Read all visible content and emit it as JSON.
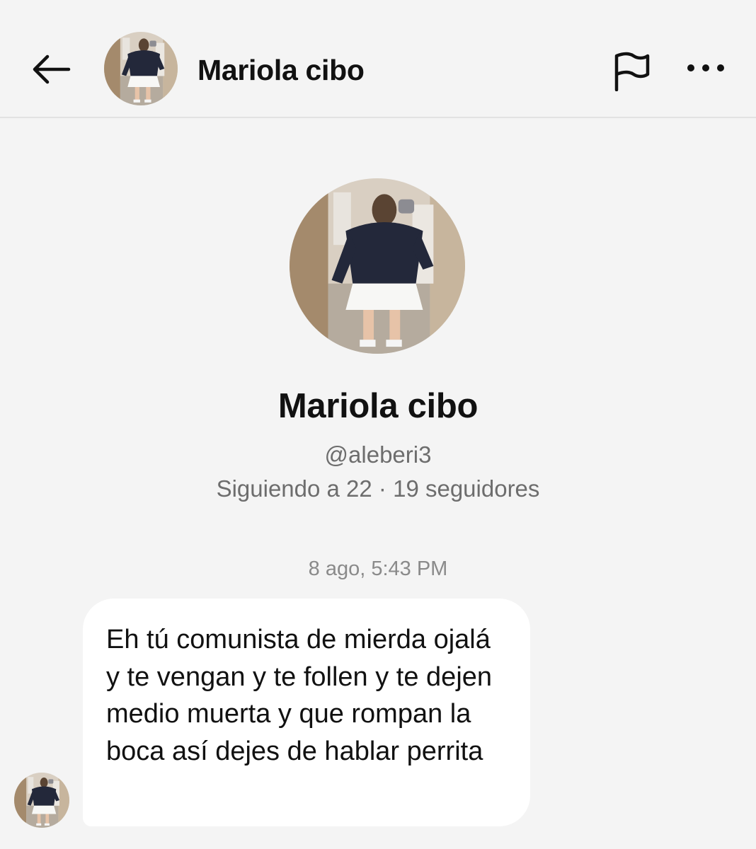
{
  "header": {
    "back_icon": "arrow-left-icon",
    "name": "Mariola cibo",
    "report_icon": "flag-icon",
    "more_icon": "ellipsis-horizontal-icon"
  },
  "profile": {
    "name": "Mariola cibo",
    "handle": "@aleberi3",
    "stats": "Siguiendo a 22 · 19 seguidores"
  },
  "conversation": {
    "timestamp": "8 ago, 5:43 PM",
    "messages": [
      {
        "from": "other",
        "text": "Eh tú comunista de mierda ojalá y te vengan y te follen y te dejen medio muerta y que rompan la boca así dejes de hablar perrita"
      }
    ]
  },
  "colors": {
    "background": "#f4f4f4",
    "bubble": "#ffffff",
    "secondary_text": "#6d6d6d",
    "timestamp_text": "#8a8a8a",
    "divider": "#e2e2e2"
  }
}
